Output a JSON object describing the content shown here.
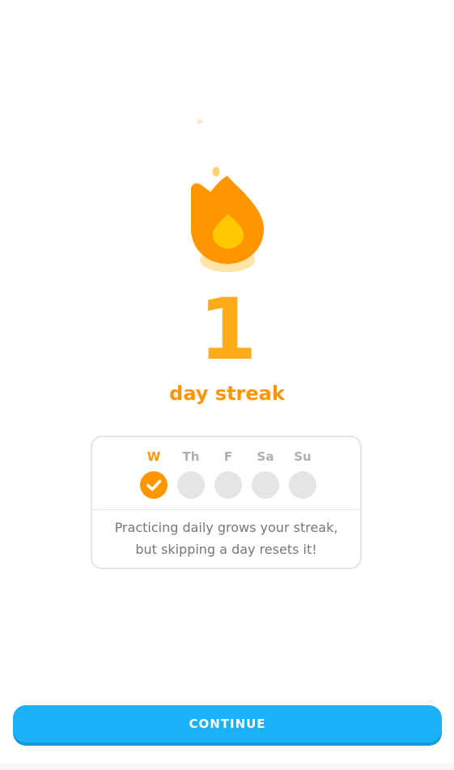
{
  "streak": {
    "count": "1",
    "label": "day streak"
  },
  "flame_icon": "fire-icon",
  "week": {
    "days": [
      {
        "label": "W",
        "done": true,
        "active": true
      },
      {
        "label": "Th",
        "done": false,
        "active": false
      },
      {
        "label": "F",
        "done": false,
        "active": false
      },
      {
        "label": "Sa",
        "done": false,
        "active": false
      },
      {
        "label": "Su",
        "done": false,
        "active": false
      }
    ],
    "message_line1": "Practicing daily grows your streak,",
    "message_line2": "but skipping a day resets it!"
  },
  "continue_button": {
    "label": "CONTINUE"
  },
  "colors": {
    "accent_orange": "#ff9600",
    "streak_number": "#ffab1a",
    "button_blue": "#1cb0f6",
    "button_shadow": "#1899d6",
    "inactive_gray": "#e5e5e5",
    "muted_text": "#777777"
  }
}
